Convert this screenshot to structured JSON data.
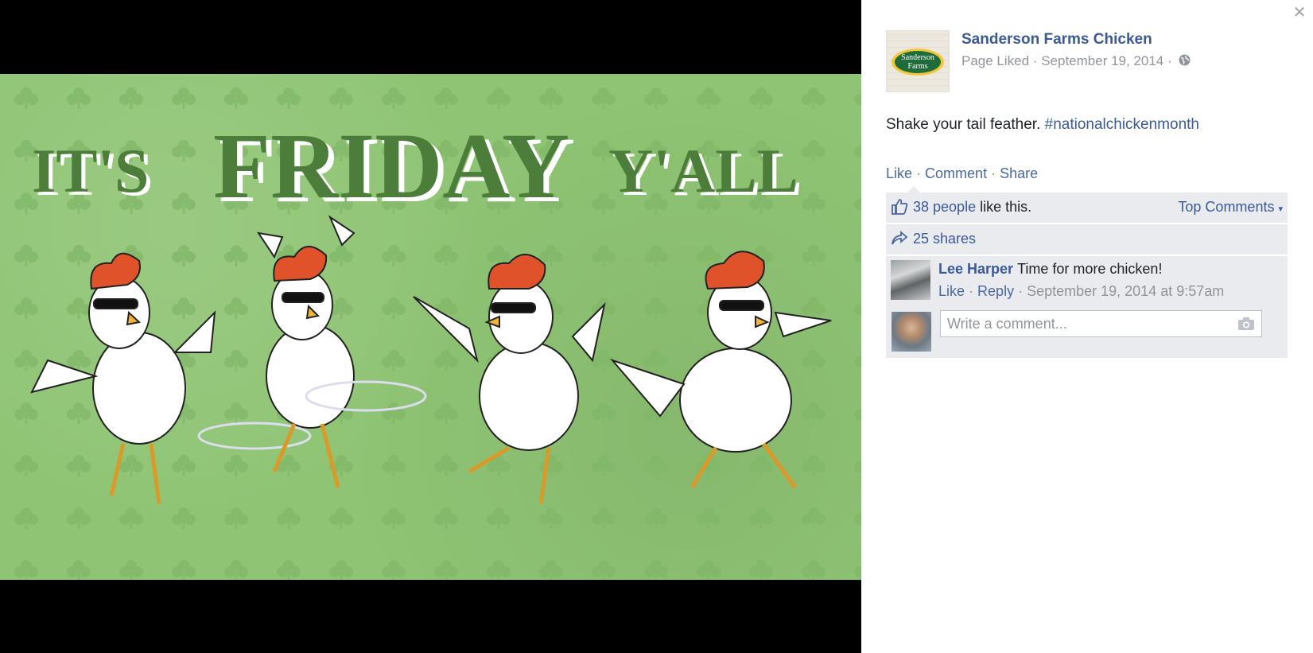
{
  "photo": {
    "headline_left": "IT'S",
    "headline_mid": "FRIDAY",
    "headline_right": "Y'ALL",
    "background_color": "#8fc474"
  },
  "panel": {
    "close_icon": "close-icon",
    "page": {
      "avatar_logo_text": "Sanderson Farms",
      "name": "Sanderson Farms Chicken",
      "status": "Page Liked",
      "date": "September 19, 2014",
      "audience_icon": "globe-icon"
    },
    "post": {
      "text": "Shake your tail feather.",
      "hashtag": "#nationalchickenmonth"
    },
    "actions": {
      "like": "Like",
      "comment": "Comment",
      "share": "Share"
    },
    "likes": {
      "count_label": "38 people",
      "suffix": "like this.",
      "sort_label": "Top Comments"
    },
    "shares": {
      "label": "25 shares"
    },
    "comment": {
      "author": "Lee Harper",
      "text": "Time for more chicken!",
      "like": "Like",
      "reply": "Reply",
      "timestamp": "September 19, 2014 at 9:57am"
    },
    "composer": {
      "placeholder": "Write a comment...",
      "camera_icon": "camera-icon"
    }
  }
}
